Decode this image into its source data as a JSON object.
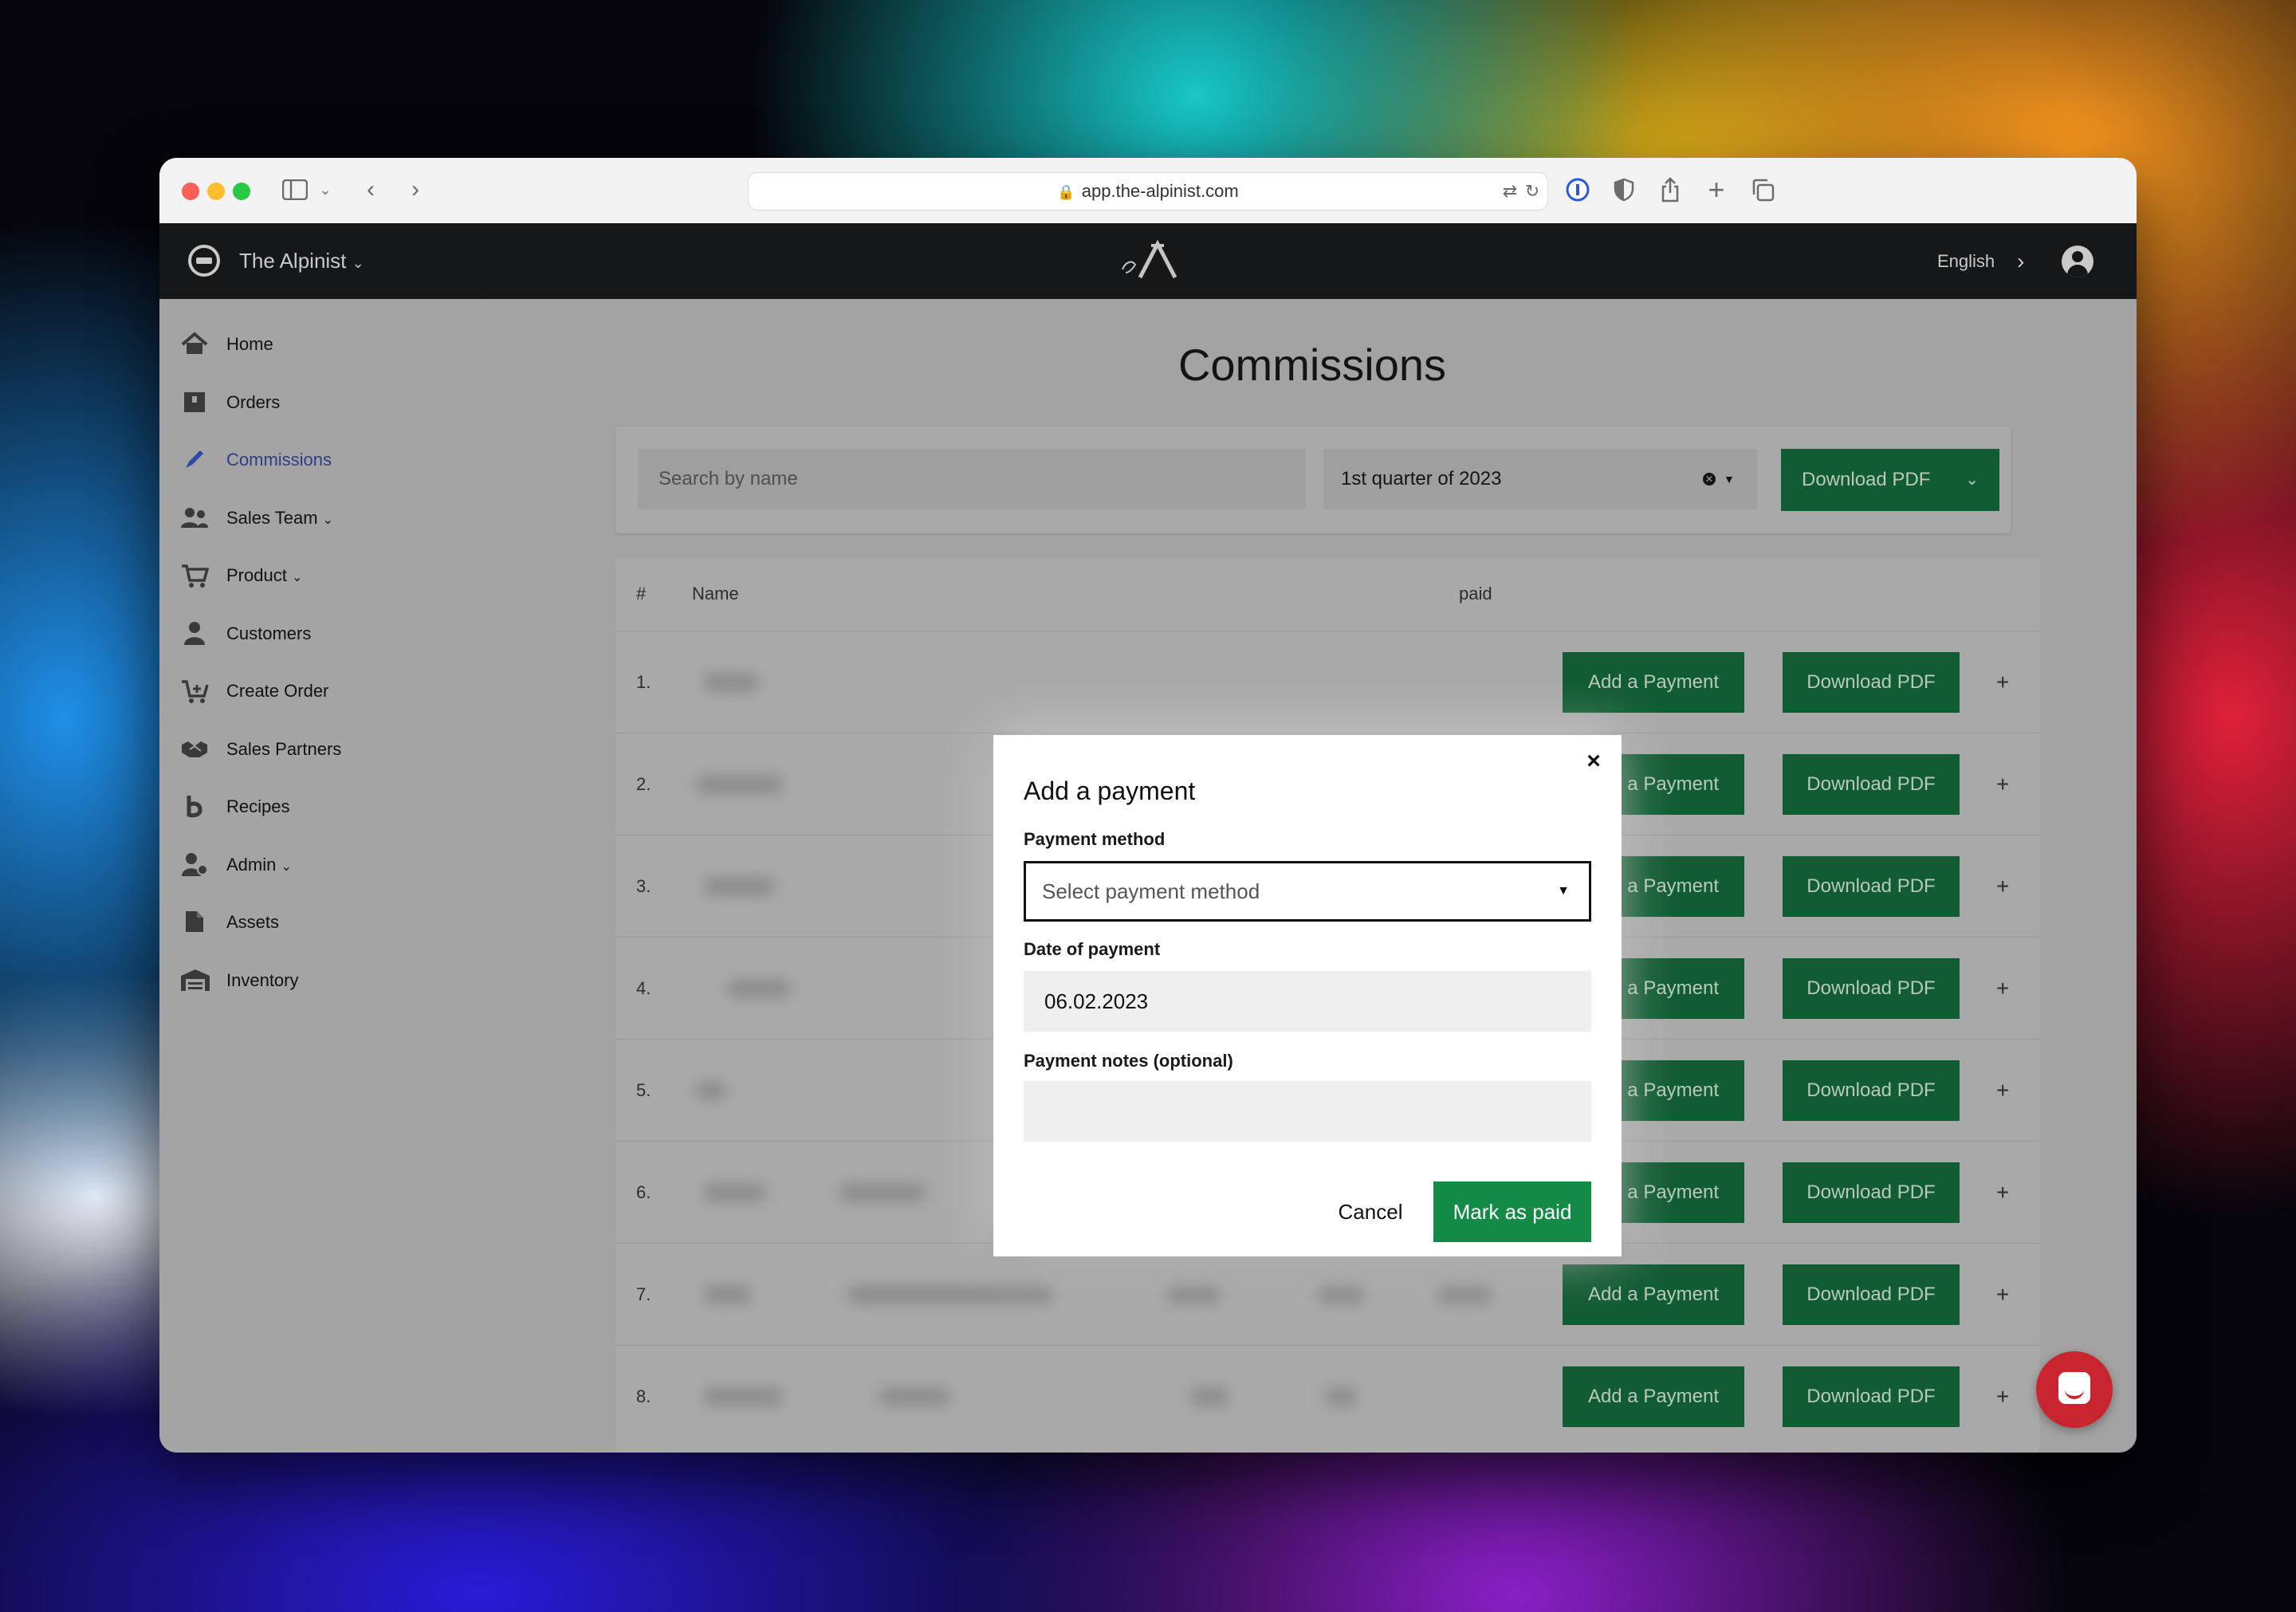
{
  "browser": {
    "url": "app.the-alpinist.com"
  },
  "appbar": {
    "brand": "The Alpinist",
    "language": "English"
  },
  "sidebar": {
    "items": [
      {
        "label": "Home",
        "icon": "home-icon"
      },
      {
        "label": "Orders",
        "icon": "box-icon"
      },
      {
        "label": "Commissions",
        "icon": "pencil-icon",
        "active": true
      },
      {
        "label": "Sales Team",
        "icon": "users-icon",
        "dropdown": true
      },
      {
        "label": "Product",
        "icon": "cart-icon",
        "dropdown": true
      },
      {
        "label": "Customers",
        "icon": "user-icon"
      },
      {
        "label": "Create Order",
        "icon": "cart-plus-icon"
      },
      {
        "label": "Sales Partners",
        "icon": "handshake-icon"
      },
      {
        "label": "Recipes",
        "icon": "recipe-icon"
      },
      {
        "label": "Admin",
        "icon": "admin-icon",
        "dropdown": true
      },
      {
        "label": "Assets",
        "icon": "file-icon"
      },
      {
        "label": "Inventory",
        "icon": "warehouse-icon"
      }
    ]
  },
  "main": {
    "title": "Commissions",
    "search_placeholder": "Search by name",
    "period": "1st quarter of 2023",
    "download_pdf": "Download PDF",
    "table": {
      "col_number": "#",
      "col_name": "Name",
      "col_paid": "paid",
      "rows": [
        "1.",
        "2.",
        "3.",
        "4.",
        "5.",
        "6.",
        "7.",
        "8."
      ],
      "add_payment": "Add a Payment",
      "download_pdf": "Download PDF",
      "expand": "+"
    }
  },
  "modal": {
    "title": "Add a payment",
    "payment_method_label": "Payment method",
    "payment_method_placeholder": "Select payment method",
    "date_label": "Date of payment",
    "date_value": "06.02.2023",
    "notes_label": "Payment notes (optional)",
    "notes_value": "",
    "cancel": "Cancel",
    "submit": "Mark as paid"
  },
  "colors": {
    "primary_green": "#148a47",
    "dark_header": "#151719",
    "active_nav": "#2c3e86",
    "chat": "#c8252f"
  }
}
